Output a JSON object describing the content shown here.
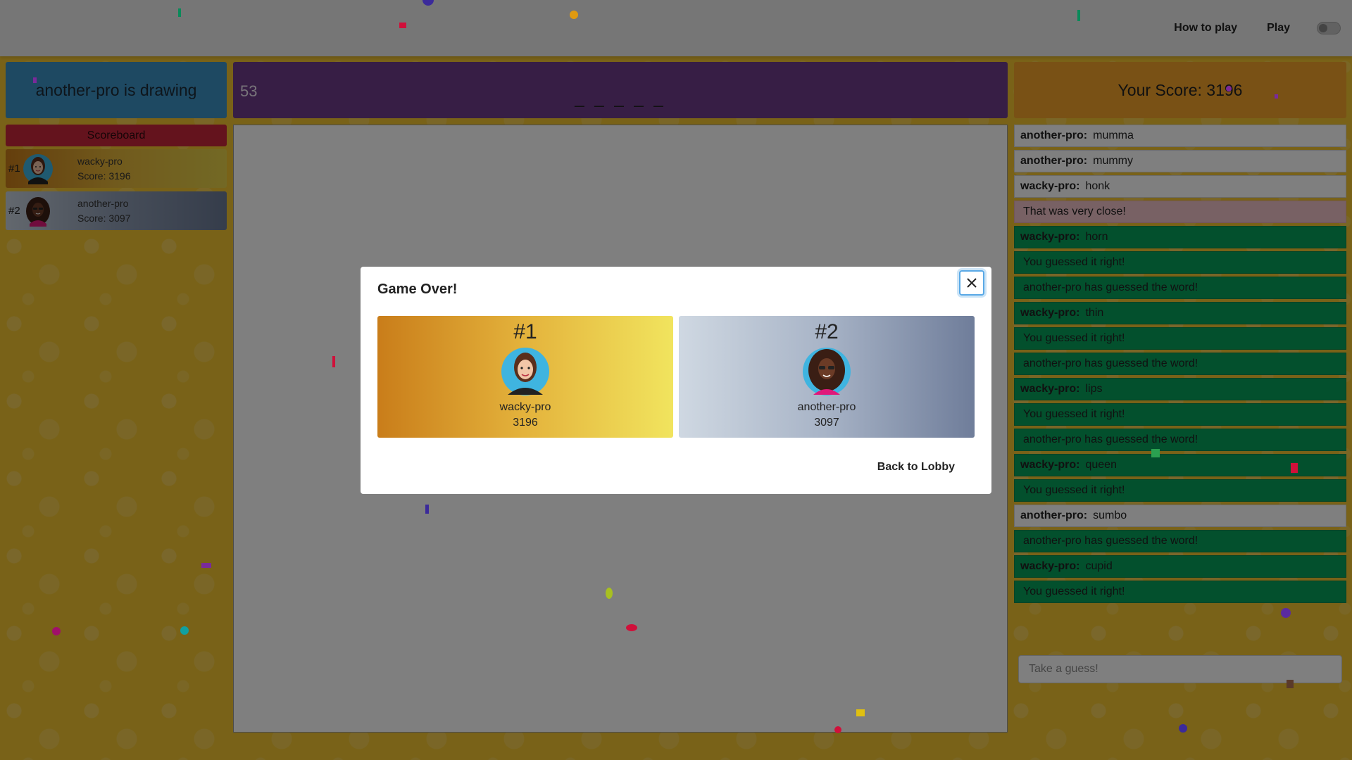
{
  "nav": {
    "how_to_play": "How to play",
    "play": "Play"
  },
  "game": {
    "drawer_status": "another-pro is drawing",
    "timer": "53",
    "word_hint": "_ _ _ _ _",
    "your_score": "Your Score: 3196"
  },
  "scoreboard": {
    "title": "Scoreboard",
    "players": [
      {
        "rank": "#1",
        "name": "wacky-pro",
        "score": "Score: 3196"
      },
      {
        "rank": "#2",
        "name": "another-pro",
        "score": "Score: 3097"
      }
    ]
  },
  "chat": {
    "messages": [
      {
        "type": "normal",
        "who": "another-pro:",
        "text": "mumma"
      },
      {
        "type": "normal",
        "who": "another-pro:",
        "text": "mummy"
      },
      {
        "type": "normal",
        "who": "wacky-pro:",
        "text": "honk"
      },
      {
        "type": "close",
        "who": "",
        "text": "That was very close!"
      },
      {
        "type": "guess",
        "who": "wacky-pro:",
        "text": "horn"
      },
      {
        "type": "system",
        "who": "",
        "text": "You guessed it right!"
      },
      {
        "type": "system",
        "who": "",
        "text": "another-pro has guessed the word!"
      },
      {
        "type": "guess",
        "who": "wacky-pro:",
        "text": "thin"
      },
      {
        "type": "system",
        "who": "",
        "text": "You guessed it right!"
      },
      {
        "type": "system",
        "who": "",
        "text": "another-pro has guessed the word!"
      },
      {
        "type": "guess",
        "who": "wacky-pro:",
        "text": "lips"
      },
      {
        "type": "system",
        "who": "",
        "text": "You guessed it right!"
      },
      {
        "type": "system",
        "who": "",
        "text": "another-pro has guessed the word!"
      },
      {
        "type": "guess",
        "who": "wacky-pro:",
        "text": "queen"
      },
      {
        "type": "system",
        "who": "",
        "text": "You guessed it right!"
      },
      {
        "type": "normal",
        "who": "another-pro:",
        "text": "sumbo"
      },
      {
        "type": "system",
        "who": "",
        "text": "another-pro has guessed the word!"
      },
      {
        "type": "guess",
        "who": "wacky-pro:",
        "text": "cupid"
      },
      {
        "type": "system",
        "who": "",
        "text": "You guessed it right!"
      }
    ],
    "input_placeholder": "Take a guess!"
  },
  "modal": {
    "title": "Game Over!",
    "close_icon": "close-icon",
    "results": [
      {
        "rank": "#1",
        "name": "wacky-pro",
        "score": "3196"
      },
      {
        "rank": "#2",
        "name": "another-pro",
        "score": "3097"
      }
    ],
    "back_to_lobby": "Back to Lobby"
  },
  "colors": {
    "background": "#f2c531",
    "drawer_box": "#3c92c4",
    "timer_box": "#6e3d8a",
    "score_box": "#f2a22a",
    "scoreboard_title": "#c9263a",
    "chat_correct": "#06a05a",
    "chat_close": "#f1c2c8"
  }
}
